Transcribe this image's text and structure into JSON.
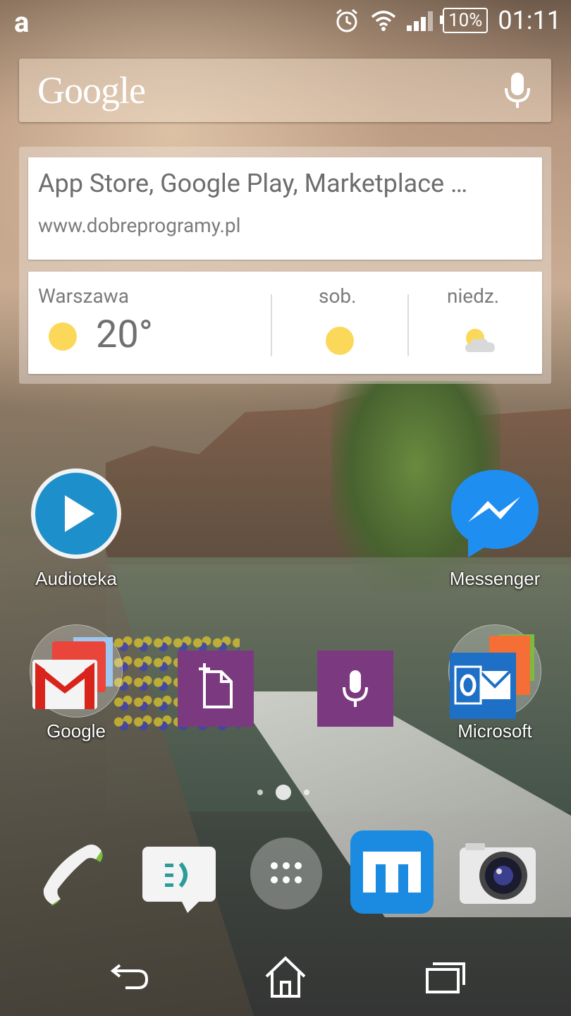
{
  "status_bar": {
    "left_logo": "a",
    "battery": "10%",
    "time": "01:11",
    "icons": [
      "alarm-icon",
      "wifi-icon",
      "signal-icon",
      "battery-icon"
    ]
  },
  "search": {
    "logo": "Google",
    "mic_icon": "mic-icon"
  },
  "now_card": {
    "link_title": "App Store, Google Play, Marketplace …",
    "link_url": "www.dobreprogramy.pl",
    "weather": {
      "city": "Warszawa",
      "temp": "20°",
      "day1": "sob.",
      "day2": "niedz.",
      "today_icon": "sun-icon",
      "day1_icon": "sun-icon",
      "day2_icon": "partly-cloudy-icon"
    }
  },
  "home": {
    "audioteka": "Audioteka",
    "messenger": "Messenger",
    "google_folder": "Google",
    "microsoft_folder": "Microsoft"
  },
  "colors": {
    "tile_purple": "#7b3a80",
    "messenger_blue": "#1f8ef1",
    "maxthon_blue": "#1a8be0"
  }
}
